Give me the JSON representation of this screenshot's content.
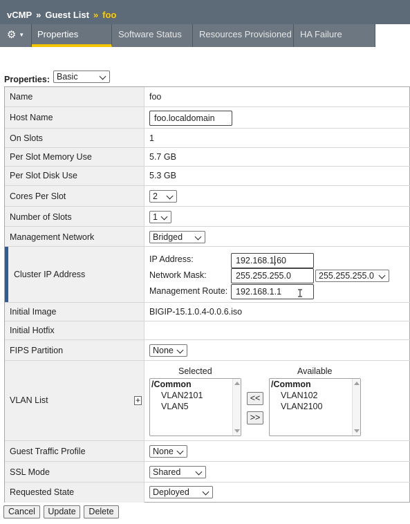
{
  "breadcrumb": {
    "part1": "vCMP",
    "sep": "»",
    "part2": "Guest List",
    "part3": "foo"
  },
  "tabs": [
    {
      "label": "Properties"
    },
    {
      "label": "Software Status"
    },
    {
      "label": "Resources Provisioned"
    },
    {
      "label": "HA Failure"
    }
  ],
  "gear": {
    "icon": "⚙",
    "caret": "▼"
  },
  "properties_selector": {
    "label": "Properties:",
    "value": "Basic"
  },
  "fields": {
    "name": {
      "label": "Name",
      "value": "foo"
    },
    "host_name": {
      "label": "Host Name",
      "value": "foo.localdomain"
    },
    "on_slots": {
      "label": "On Slots",
      "value": "1"
    },
    "per_slot_memory": {
      "label": "Per Slot Memory Use",
      "value": "5.7 GB"
    },
    "per_slot_disk": {
      "label": "Per Slot Disk Use",
      "value": "5.3 GB"
    },
    "cores_per_slot": {
      "label": "Cores Per Slot",
      "value": "2"
    },
    "number_of_slots": {
      "label": "Number of Slots",
      "value": "1"
    },
    "management_network": {
      "label": "Management Network",
      "value": "Bridged"
    },
    "cluster_ip": {
      "label": "Cluster IP Address",
      "ip_label": "IP Address:",
      "ip_value": "192.168.1.60",
      "mask_label": "Network Mask:",
      "mask_value": "255.255.255.0",
      "mask_select": "255.255.255.0",
      "route_label": "Management Route:",
      "route_value": "192.168.1.1"
    },
    "initial_image": {
      "label": "Initial Image",
      "value": "BIGIP-15.1.0.4-0.0.6.iso"
    },
    "initial_hotfix": {
      "label": "Initial Hotfix",
      "value": ""
    },
    "fips_partition": {
      "label": "FIPS Partition",
      "value": "None"
    },
    "vlan_list": {
      "label": "VLAN List",
      "plus": "+",
      "selected_header": "Selected",
      "available_header": "Available",
      "selected_items": [
        "/Common",
        "VLAN2101",
        "VLAN5"
      ],
      "available_items": [
        "/Common",
        "VLAN102",
        "VLAN2100"
      ],
      "move_left": "<<",
      "move_right": ">>"
    },
    "guest_traffic_profile": {
      "label": "Guest Traffic Profile",
      "value": "None"
    },
    "ssl_mode": {
      "label": "SSL Mode",
      "value": "Shared"
    },
    "requested_state": {
      "label": "Requested State",
      "value": "Deployed"
    }
  },
  "actions": {
    "cancel": "Cancel",
    "update": "Update",
    "delete": "Delete"
  }
}
